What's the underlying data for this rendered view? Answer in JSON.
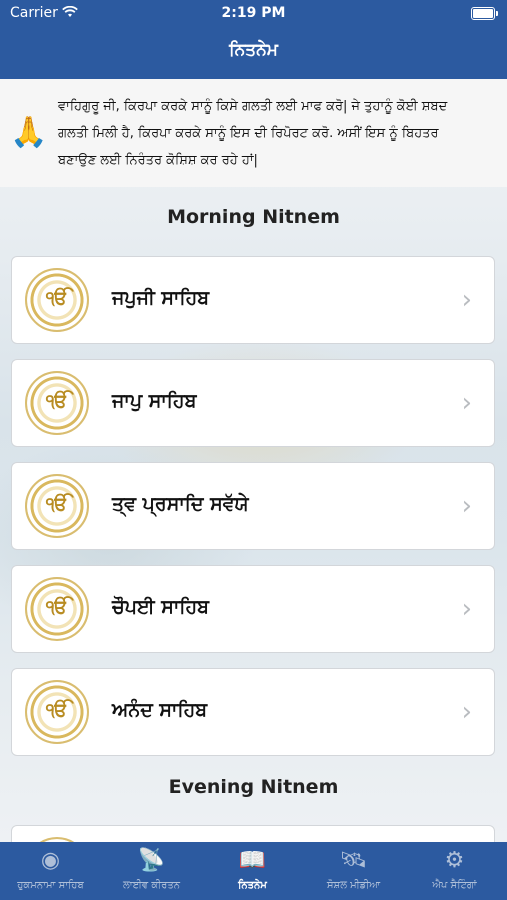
{
  "status": {
    "carrier": "Carrier",
    "time": "2:19 PM"
  },
  "nav": {
    "title": "ਨਿਤਨੇਮ"
  },
  "notice": {
    "icon": "🙏",
    "text": "ਵਾਹਿਗੁਰੂ ਜੀ, ਕਿਰਪਾ ਕਰਕੇ ਸਾਨੂੰ ਕਿਸੇ ਗਲਤੀ ਲਈ ਮਾਫ ਕਰੋ| ਜੇ ਤੁਹਾਨੂੰ ਕੋਈ ਸ਼ਬਦ ਗਲਤੀ ਮਿਲੀ ਹੈ, ਕਿਰਪਾ ਕਰਕੇ ਸਾਨੂੰ ਇਸ ਦੀ ਰਿਪੋਰਟ ਕਰੋ. ਅਸੀਂ ਇਸ ਨੂੰ ਬਿਹਤਰ ਬਣਾਉਣ ਲਈ ਨਿਰੰਤਰ ਕੋਸ਼ਿਸ਼ ਕਰ ਰਹੇ ਹਾਂ|"
  },
  "morning": {
    "title": "Morning Nitnem",
    "items": [
      {
        "label": "ਜਪੁਜੀ ਸਾਹਿਬ"
      },
      {
        "label": "ਜਾਪੁ ਸਾਹਿਬ"
      },
      {
        "label": "ਤ੍ਵ ਪ੍ਰਸਾਦਿ ਸਵੱਯੇ"
      },
      {
        "label": "ਚੌਪਈ ਸਾਹਿਬ"
      },
      {
        "label": "ਅਨੰਦ ਸਾਹਿਬ"
      }
    ]
  },
  "evening": {
    "title": "Evening Nitnem"
  },
  "card_glyph": "ੴ",
  "tabs": [
    {
      "label": "ਹੁਕਮਨਾਮਾ ਸਾਹਿਬ",
      "icon": "hukamnama-icon",
      "glyph": "◉"
    },
    {
      "label": "ਲਾਈਵ ਕੀਰਤਨ",
      "icon": "broadcast-tower-icon",
      "glyph": "📡"
    },
    {
      "label": "ਨਿਤਨੇਮ",
      "icon": "book-icon",
      "glyph": "📖"
    },
    {
      "label": "ਸੋਸ਼ਲ ਮੀਡੀਆ",
      "icon": "satellite-icon",
      "glyph": "🛰"
    },
    {
      "label": "ਐਪ ਸੈਟਿੰਗਾਂ",
      "icon": "gear-icon",
      "glyph": "⚙"
    }
  ],
  "colors": {
    "brand": "#2c5aa0",
    "tab_inactive": "#aebfd8",
    "tab_active": "#ffffff"
  }
}
